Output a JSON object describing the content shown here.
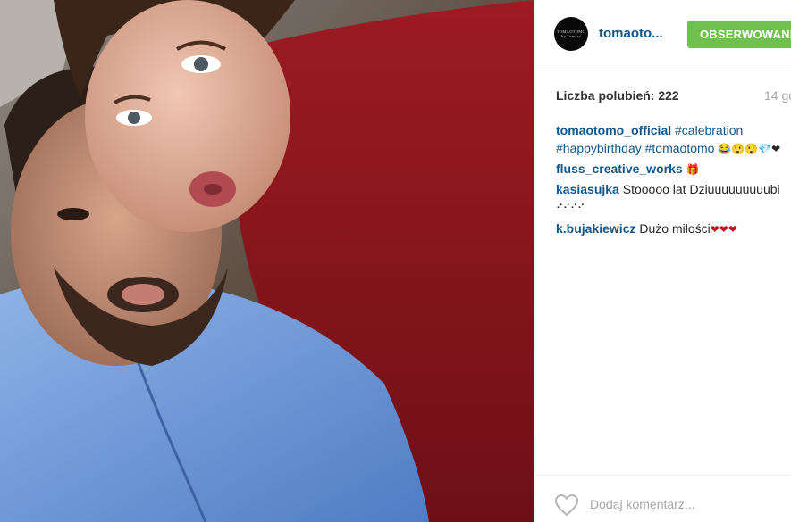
{
  "post": {
    "image_alt": "",
    "username_short": "tomaoto...",
    "avatar_text": "TOMAOTOMO",
    "avatar_subtext": "by Tomasz",
    "follow_label": "OBSERWOWANE",
    "likes_text": "Liczba polubień: 222",
    "time_text": "14 go",
    "add_comment_placeholder": "Dodaj komentarz..."
  },
  "comments": [
    {
      "user": "tomaotomo_official",
      "line1_tag": "#calebration",
      "line2_tags": "#happybirthday #tomaotomo",
      "line2_emoji": "😂😲😲💎❤"
    },
    {
      "user": "fluss_creative_works",
      "emoji": "🎁"
    },
    {
      "user": "kasiasujka",
      "text": "Stooooo lat Dziuuuuuuuuubi",
      "line2": "⠊⠊⠊⠊"
    },
    {
      "user": "k.bujakiewicz",
      "text": "Dużo miłości",
      "emoji": "❤❤❤"
    }
  ],
  "colors": {
    "link": "#125688",
    "follow": "#70c050",
    "muted": "#a5a7aa"
  }
}
